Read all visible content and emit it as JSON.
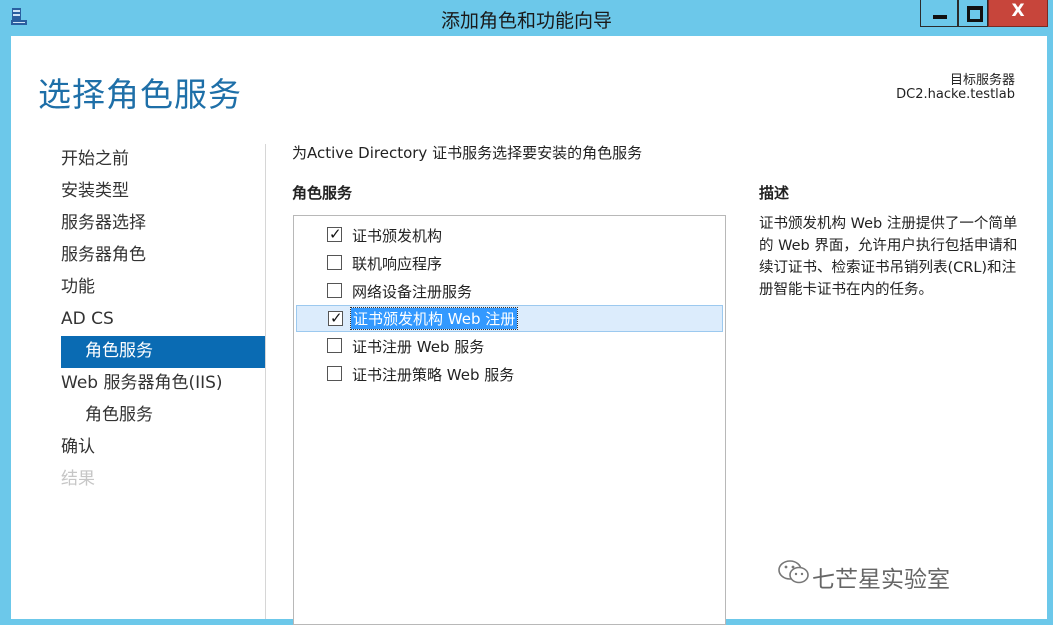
{
  "window": {
    "title": "添加角色和功能向导",
    "close_glyph": "X"
  },
  "header": {
    "page_title": "选择角色服务",
    "target_label": "目标服务器",
    "target_server": "DC2.hacke.testlab"
  },
  "nav": {
    "items": [
      {
        "label": "开始之前",
        "state": "normal"
      },
      {
        "label": "安装类型",
        "state": "normal"
      },
      {
        "label": "服务器选择",
        "state": "normal"
      },
      {
        "label": "服务器角色",
        "state": "normal"
      },
      {
        "label": "功能",
        "state": "normal"
      },
      {
        "label": "AD CS",
        "state": "normal"
      },
      {
        "label": "角色服务",
        "state": "selected"
      },
      {
        "label": "Web 服务器角色(IIS)",
        "state": "normal"
      },
      {
        "label": "角色服务",
        "state": "sub"
      },
      {
        "label": "确认",
        "state": "normal"
      },
      {
        "label": "结果",
        "state": "disabled"
      }
    ]
  },
  "main": {
    "instruction": "为Active Directory 证书服务选择要安装的角色服务",
    "column_header": "角色服务",
    "role_services": [
      {
        "label": "证书颁发机构",
        "checked": true,
        "selected": false
      },
      {
        "label": "联机响应程序",
        "checked": false,
        "selected": false
      },
      {
        "label": "网络设备注册服务",
        "checked": false,
        "selected": false
      },
      {
        "label": "证书颁发机构 Web 注册",
        "checked": true,
        "selected": true
      },
      {
        "label": "证书注册 Web 服务",
        "checked": false,
        "selected": false
      },
      {
        "label": "证书注册策略 Web 服务",
        "checked": false,
        "selected": false
      }
    ],
    "check_glyph": "✓"
  },
  "description": {
    "header": "描述",
    "text": "证书颁发机构 Web 注册提供了一个简单的 Web 界面，允许用户执行包括申请和续订证书、检索证书吊销列表(CRL)和注册智能卡证书在内的任务。"
  },
  "watermark": {
    "text": "七芒星实验室"
  },
  "colors": {
    "titlebar": "#6cc8ea",
    "accent": "#0a6bb3",
    "page_title": "#1e6fa8",
    "close_button": "#c7453b"
  }
}
